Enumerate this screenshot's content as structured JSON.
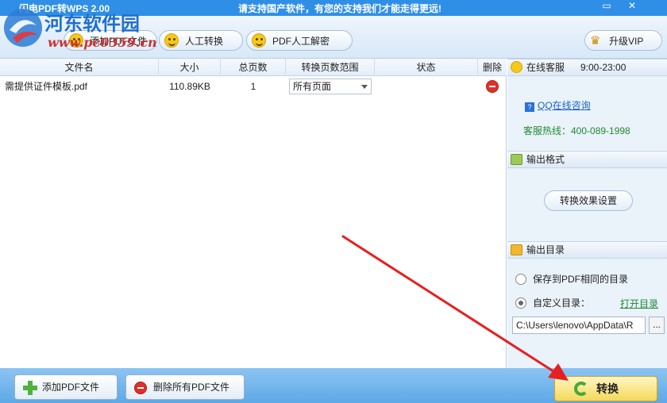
{
  "titlebar": {
    "app_title": "闪电PDF转WPS 2.00",
    "slogan": "请支持国产软件，有您的支持我们才能走得更远!",
    "minimize": "▭",
    "close": "✕"
  },
  "watermark": {
    "name": "河东软件园",
    "url": "www.pc0359.cn"
  },
  "toolbar": {
    "add_pdf": "添加PDF文件",
    "manual_convert": "人工转换",
    "pdf_manual_decrypt": "PDF人工解密",
    "upgrade_vip": "升级VIP"
  },
  "table": {
    "headers": {
      "name": "文件名",
      "size": "大小",
      "pages": "总页数",
      "range": "转换页数范围",
      "status": "状态",
      "delete": "删除"
    },
    "rows": [
      {
        "name": "需提供证件模板.pdf",
        "size": "110.89KB",
        "pages": "1",
        "range": "所有页面",
        "status": ""
      }
    ]
  },
  "support": {
    "title": "在线客服",
    "hours": "9:00-23:00",
    "qq_link": "QQ在线咨询",
    "qq_icon_char": "?",
    "hotline": "客服热线：400-089-1998"
  },
  "output_format": {
    "title": "输出格式",
    "settings_button": "转换效果设置"
  },
  "output_dir": {
    "title": "输出目录",
    "option_same": "保存到PDF相同的目录",
    "option_custom": "自定义目录：",
    "open_dir": "打开目录",
    "path_value": "C:\\Users\\lenovo\\AppData\\R",
    "browse": "..."
  },
  "bottombar": {
    "add_pdf": "添加PDF文件",
    "delete_all": "删除所有PDF文件",
    "convert": "转换"
  },
  "colors": {
    "titlebar_bg": "#2f8fe6",
    "link_green": "#1f8a32",
    "link_blue": "#1a63c7",
    "delete_red": "#e0302a",
    "annotation_red": "#e62020"
  }
}
